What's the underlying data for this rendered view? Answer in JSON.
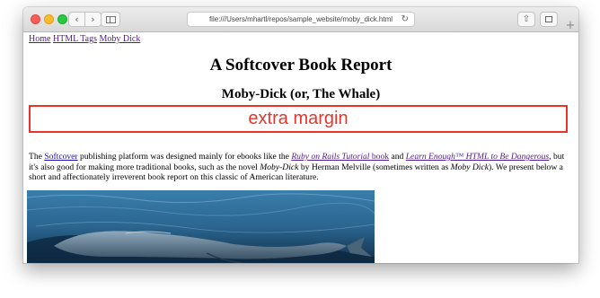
{
  "browser": {
    "url": "file:///Users/mhartl/repos/sample_website/moby_dick.html",
    "back_glyph": "‹",
    "forward_glyph": "›",
    "reload_glyph": "↻",
    "share_glyph": "⇧",
    "new_tab_glyph": "+",
    "icons": [
      "close-icon",
      "minimize-icon",
      "zoom-icon",
      "back-icon",
      "forward-icon",
      "sidebar-icon",
      "reload-icon",
      "share-icon",
      "tabs-icon",
      "new-tab-icon"
    ]
  },
  "nav": {
    "home": "Home",
    "html_tags": "HTML Tags",
    "moby_dick": "Moby Dick"
  },
  "page": {
    "title": "A Softcover Book Report",
    "subtitle": "Moby-Dick (or, The Whale)",
    "margin_box_text": "extra margin"
  },
  "paragraph": {
    "p1": "The ",
    "softcover_link": "Softcover",
    "p2": " publishing platform was designed mainly for ebooks like the ",
    "rails_link_italic": "Ruby on Rails Tutorial",
    "rails_link_book": " book",
    "p3": " and ",
    "learn_enough_link": "Learn Enough™ HTML to Be Dangerous",
    "p4": ", but it's also good for making more traditional books, such as the novel ",
    "moby_italic": "Moby-Dick",
    "p5": " by Herman Melville (sometimes written as ",
    "moby_italic_2": "Moby Dick",
    "p6": "). We present below a short and affectionately irreverent book report on this classic of American literature."
  },
  "colors": {
    "accent_red": "#e8352c",
    "link": "#1a0dab",
    "visited_link": "#551a8b"
  }
}
